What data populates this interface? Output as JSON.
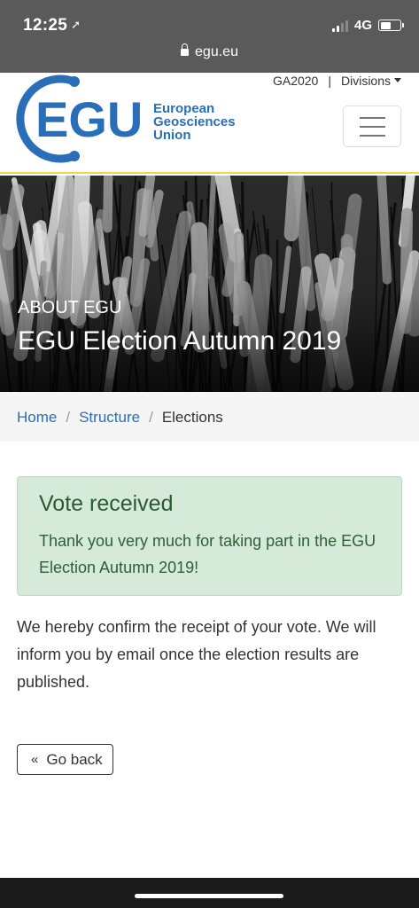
{
  "status_bar": {
    "time": "12:25",
    "network": "4G",
    "url": "egu.eu"
  },
  "header": {
    "logo_letters": "EGU",
    "logo_words": [
      "European",
      "Geosciences",
      "Union"
    ],
    "topnav": {
      "ga_link": "GA2020",
      "separator": "|",
      "divisions": "Divisions"
    },
    "menu_icon": "hamburger-icon",
    "accent_color": "#2a6eb7"
  },
  "hero": {
    "kicker": "ABOUT EGU",
    "title": "EGU Election Autumn 2019"
  },
  "breadcrumb": {
    "items": [
      "Home",
      "Structure"
    ],
    "current": "Elections",
    "separator": "/"
  },
  "alert": {
    "heading": "Vote received",
    "text": "Thank you very much for taking part in the EGU Election Autumn 2019!",
    "color": "#d5ead9"
  },
  "confirmation": "We hereby confirm the receipt of your vote. We will inform you by email once the election results are published.",
  "back_button": {
    "label": "Go back",
    "icon": "double-chevron-left-icon"
  }
}
